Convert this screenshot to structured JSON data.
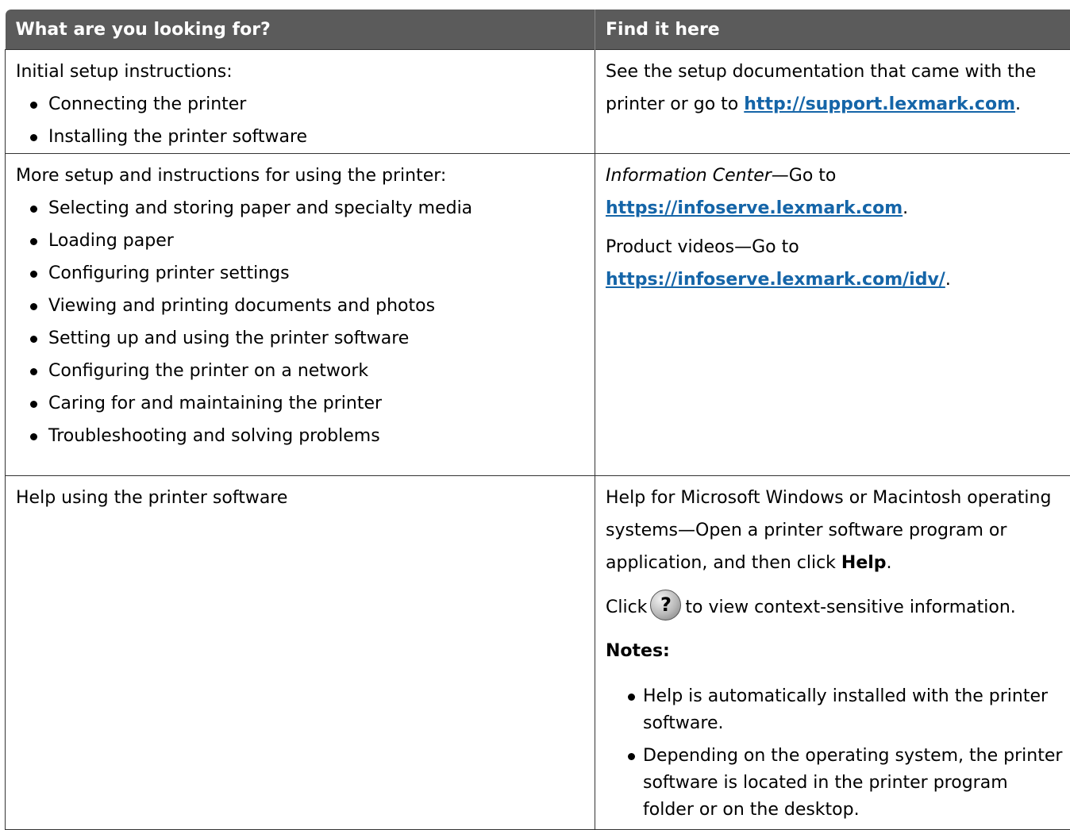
{
  "table": {
    "headers": [
      "What are you looking for?",
      "Find it here"
    ],
    "row1": {
      "left_intro": "Initial setup instructions:",
      "left_items": [
        "Connecting the printer",
        "Installing the printer software"
      ],
      "right_text": "See the setup documentation that came with the printer or go to ",
      "right_link": "http://support.lexmark.com",
      "right_end": "."
    },
    "row2": {
      "left_intro": "More setup and instructions for using the printer:",
      "left_items": [
        "Selecting and storing paper and specialty media",
        "Loading paper",
        "Configuring printer settings",
        "Viewing and printing documents and photos",
        "Setting up and using the printer software",
        "Configuring the printer on a network",
        "Caring for and maintaining the printer",
        "Troubleshooting and solving problems"
      ],
      "right_p1_italic": "Information Center",
      "right_p1_text": "—Go to",
      "right_p1_link": "https://infoserve.lexmark.com",
      "right_p2_text": "Product videos—Go to",
      "right_p2_link": "https://infoserve.lexmark.com/idv/",
      "period": "."
    },
    "row3": {
      "left_text": "Help using the printer software",
      "right_p1": "Help for Microsoft Windows or Macintosh operating systems—Open a printer software program or application, and then click ",
      "right_p1_bold": "Help",
      "right_p1_end": ".",
      "click_word": "Click",
      "help_icon_glyph": "?",
      "click_after": "to view context-sensitive information.",
      "notes_label": "Notes:",
      "notes": [
        "Help is automatically installed with the printer software.",
        "Depending on the operating system, the printer software is located in the printer program folder or on the desktop."
      ]
    }
  }
}
